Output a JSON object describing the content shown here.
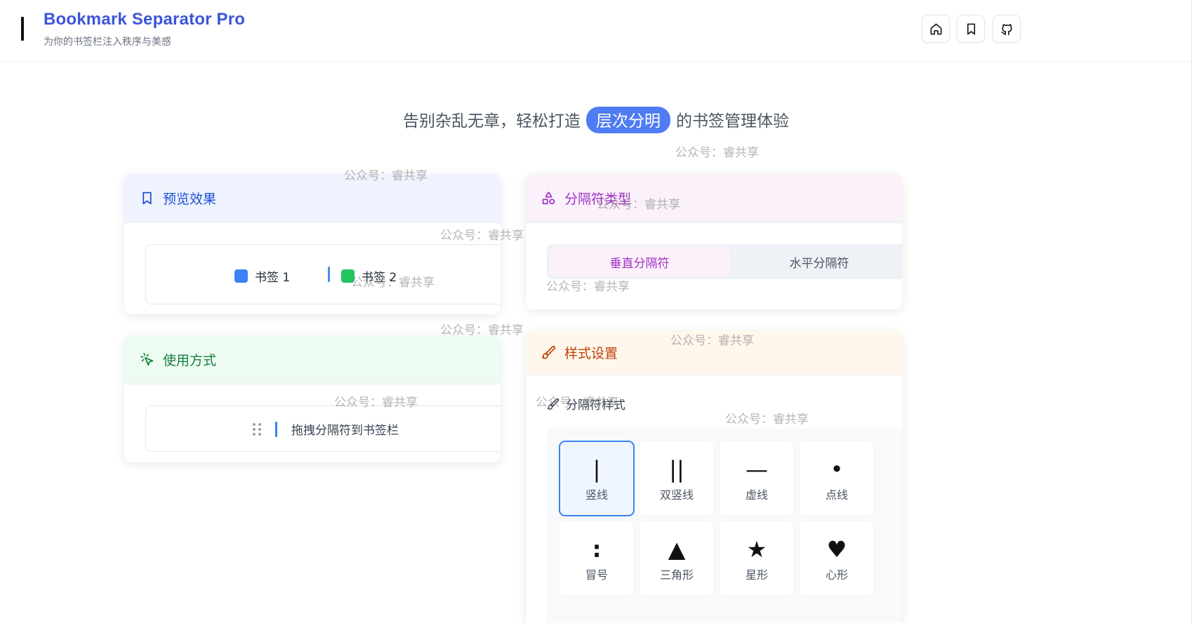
{
  "header": {
    "title": "Bookmark Separator Pro",
    "subtitle": "为你的书签栏注入秩序与美感",
    "buttons": [
      {
        "icon": "home-icon"
      },
      {
        "icon": "bookmark-icon"
      },
      {
        "icon": "github-icon"
      }
    ]
  },
  "headline": {
    "before": "告别杂乱无章，轻松打造",
    "highlight": "层次分明",
    "after": "的书签管理体验"
  },
  "preview_card": {
    "title": "预览效果",
    "bookmark1": {
      "label": "书签 1",
      "color": "#3b82f6"
    },
    "bookmark2": {
      "label": "书签 2",
      "color": "#22c55e"
    }
  },
  "usage_card": {
    "title": "使用方式",
    "instruction": "拖拽分隔符到书签栏"
  },
  "type_card": {
    "title": "分隔符类型",
    "options": [
      {
        "label": "垂直分隔符",
        "selected": true
      },
      {
        "label": "水平分隔符",
        "selected": false
      }
    ]
  },
  "style_card": {
    "title": "样式设置",
    "section_label": "分隔符样式",
    "styles": [
      {
        "glyph": "|",
        "label": "竖线",
        "selected": true
      },
      {
        "glyph": "||",
        "label": "双竖线",
        "selected": false
      },
      {
        "glyph": "—",
        "label": "虚线",
        "selected": false
      },
      {
        "glyph": "•",
        "label": "点线",
        "selected": false
      },
      {
        "glyph": ":",
        "label": "冒号",
        "selected": false
      },
      {
        "glyph": "▲",
        "label": "三角形",
        "selected": false
      },
      {
        "glyph": "★",
        "label": "星形",
        "selected": false
      },
      {
        "glyph": "♥",
        "label": "心形",
        "selected": false
      }
    ]
  },
  "watermark": "公众号：睿共享",
  "colors": {
    "brand": "#3b55d9",
    "accent_blue": "#4f7cf3",
    "purple": "#a033c4",
    "green": "#15803d",
    "orange": "#c2410c"
  }
}
